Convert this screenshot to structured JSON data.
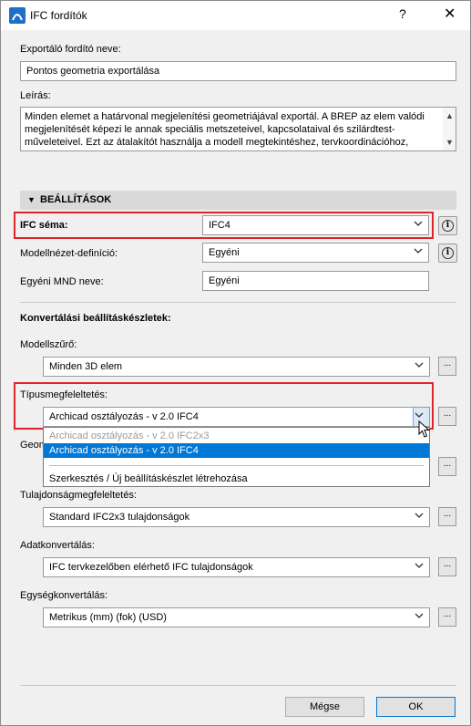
{
  "window": {
    "title": "IFC fordítók",
    "help_glyph": "?",
    "close_glyph": "✕"
  },
  "translator_name": {
    "label": "Exportáló fordító neve:",
    "value": "Pontos geometria exportálása"
  },
  "description": {
    "label": "Leírás:",
    "text": "Minden elemet a határvonal megjelenítési geometriájával exportál. A BREP az elem valódi megjelenítését képezi le annak speciális metszeteivel, kapcsolataival és szilárdtest-műveleteivel. Ezt az átalakítót használja a modell megtekintéshez, tervkoordinációhoz, hasonlósági vizsgálathoz és mennyiségszámításhoz."
  },
  "settings": {
    "section_title": "BEÁLLÍTÁSOK",
    "ifc_schema": {
      "label": "IFC séma:",
      "value": "IFC4"
    },
    "model_view": {
      "label": "Modellnézet-definíció:",
      "value": "Egyéni"
    },
    "custom_mvd": {
      "label": "Egyéni MND neve:",
      "value": "Egyéni"
    },
    "info_glyph": "i",
    "conversion_header": "Konvertálási beállításkészletek:",
    "model_filter": {
      "label": "Modellszűrő:",
      "value": "Minden 3D elem"
    },
    "type_mapping": {
      "label": "Típusmegfeleltetés:",
      "value": "Archicad osztályozás - v 2.0 IFC4",
      "options": [
        "Archicad osztályozás - v 2.0 IFC2x3",
        "Archicad osztályozás - v 2.0 IFC4",
        "Szerkesztés / Új beállításkészlet létrehozása"
      ],
      "selected_index": 1
    },
    "geometry_label_partial": "Geom",
    "property_mapping": {
      "label": "Tulajdonságmegfeleltetés:",
      "value": "Standard IFC2x3 tulajdonságok"
    },
    "data_conversion": {
      "label": "Adatkonvertálás:",
      "value": "IFC tervkezelőben elérhető IFC tulajdonságok"
    },
    "unit_conversion": {
      "label": "Egységkonvertálás:",
      "value": "Metrikus (mm) (fok) (USD)"
    },
    "dots_label": "..."
  },
  "footer": {
    "cancel_label": "Mégse",
    "ok_label": "OK"
  },
  "colors": {
    "highlight": "#e0242b",
    "selection": "#0078d7"
  }
}
